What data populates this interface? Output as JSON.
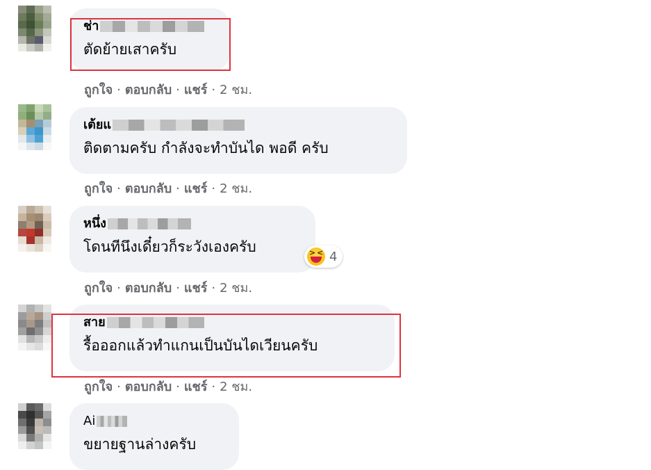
{
  "actions": {
    "like": "ถูกใจ",
    "reply": "ตอบกลับ",
    "share": "แชร์",
    "sep": "·"
  },
  "comments": [
    {
      "author": "ช่า",
      "text": "ตัดย้ายเสาครับ",
      "time": "2 ชม."
    },
    {
      "author": "เต้ยแ",
      "text": "ติดตามครับ กำลังจะทำบันได พอดี ครับ",
      "time": "2 ชม."
    },
    {
      "author": "หนึ่ง",
      "text": "โดนทีนึงเดี๋ยวก็ระวังเองครับ",
      "time": "2 ชม.",
      "reaction": {
        "icon": "laughing-emoji-icon",
        "count": "4"
      }
    },
    {
      "author": "สาย",
      "text": "รื้อออกแล้วทำแกนเป็นบันไดเวียนครับ",
      "time": "2 ชม."
    },
    {
      "author": "Ai",
      "text": "ขยายฐานล่างครับ"
    }
  ],
  "colors": {
    "bubble": "#f0f2f5",
    "meta_text": "#65676b",
    "highlight": "#e0313d"
  }
}
